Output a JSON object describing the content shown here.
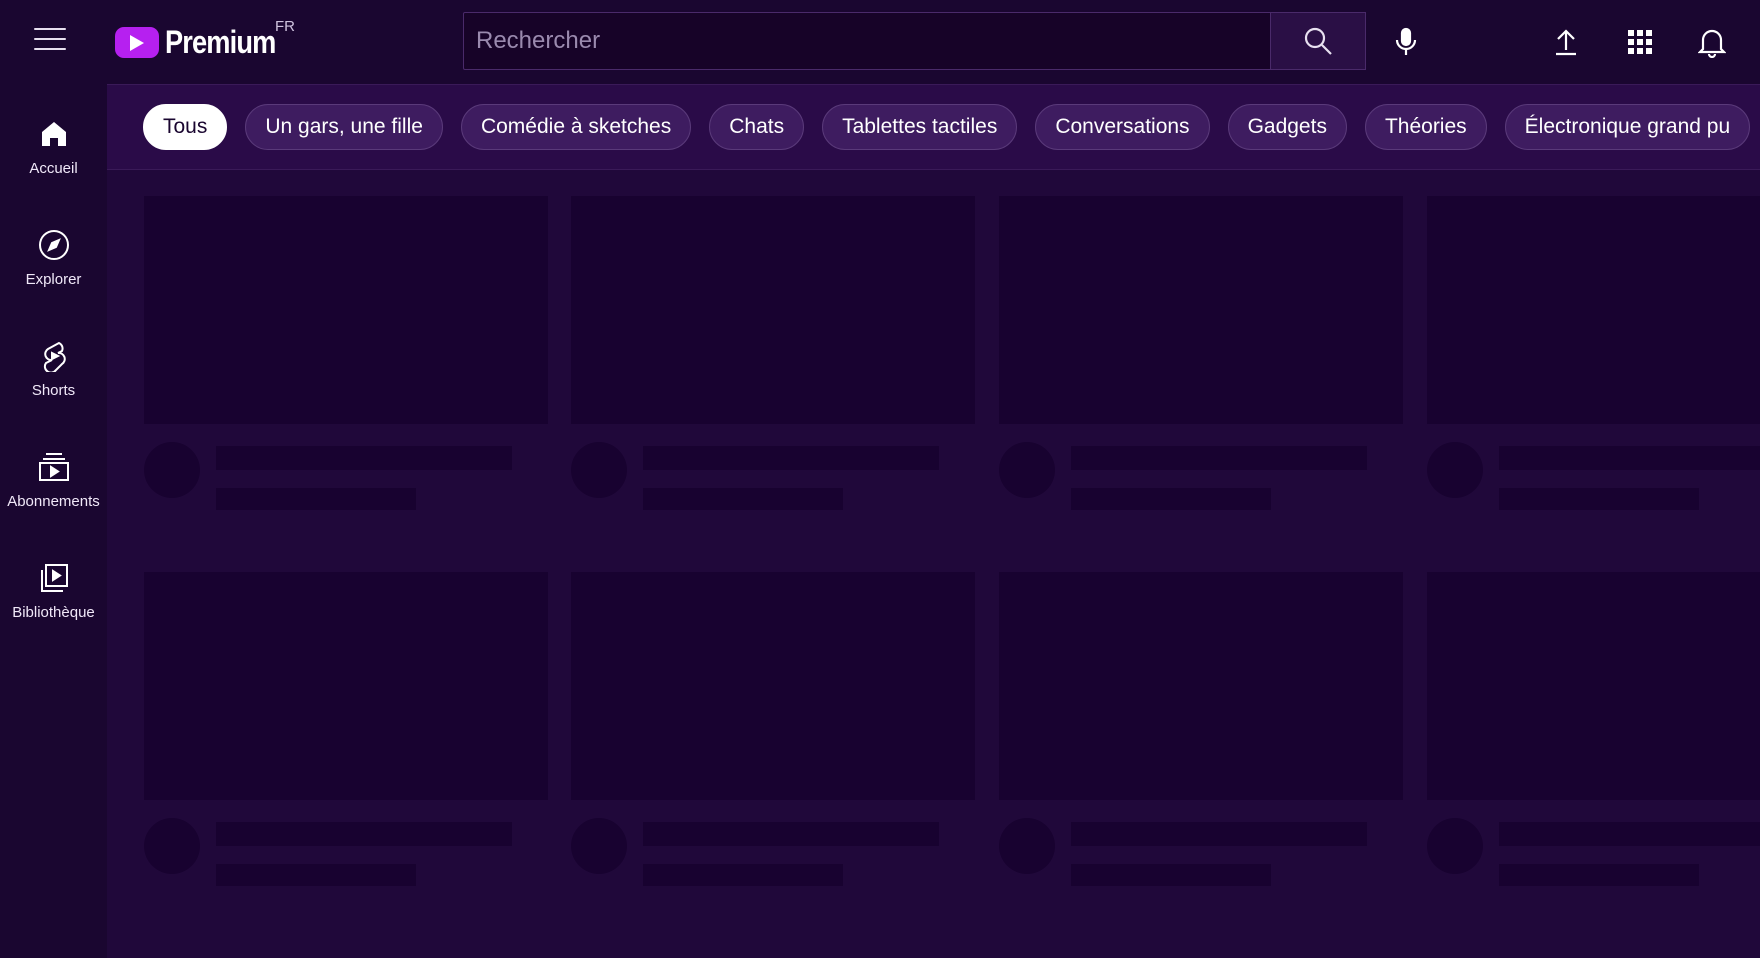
{
  "header": {
    "logo_text": "Premium",
    "country_code": "FR",
    "search_placeholder": "Rechercher",
    "brand_color": "#b620f0"
  },
  "sidebar": {
    "items": [
      {
        "label": "Accueil",
        "icon": "home-icon"
      },
      {
        "label": "Explorer",
        "icon": "compass-icon"
      },
      {
        "label": "Shorts",
        "icon": "shorts-icon"
      },
      {
        "label": "Abonnements",
        "icon": "subscriptions-icon"
      },
      {
        "label": "Bibliothèque",
        "icon": "library-icon"
      }
    ]
  },
  "chips": [
    {
      "label": "Tous",
      "active": true
    },
    {
      "label": "Un gars, une fille"
    },
    {
      "label": "Comédie à sketches"
    },
    {
      "label": "Chats"
    },
    {
      "label": "Tablettes tactiles"
    },
    {
      "label": "Conversations"
    },
    {
      "label": "Gadgets"
    },
    {
      "label": "Théories"
    },
    {
      "label": "Électronique grand pu"
    }
  ],
  "content": {
    "state": "loading",
    "rows": 2,
    "columns": 4
  }
}
